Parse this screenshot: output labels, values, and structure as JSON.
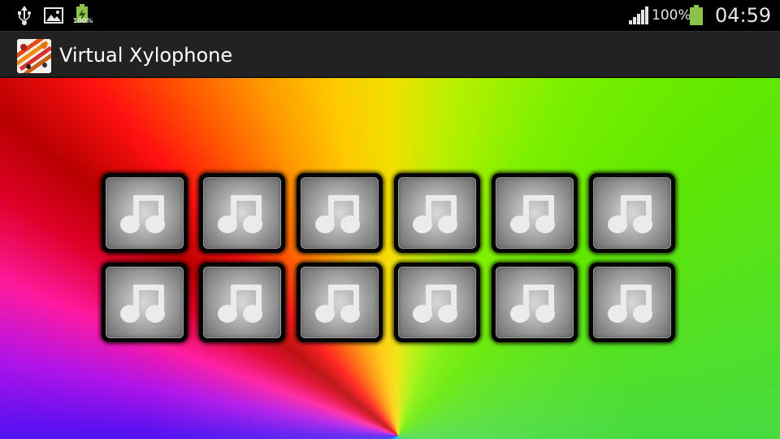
{
  "status_bar": {
    "battery_notification_text": "100%",
    "battery_level": "100%",
    "clock": "04:59",
    "icons": [
      "usb-icon",
      "image-icon",
      "battery-charging-icon",
      "signal-icon",
      "battery-icon"
    ]
  },
  "action_bar": {
    "app_icon": "xylophone-app-icon",
    "title": "Virtual Xylophone"
  },
  "keys": {
    "rows": 2,
    "columns": 6,
    "icon": "music-note-icon"
  },
  "colors": {
    "status_bar_bg": "#000000",
    "action_bar_bg": "#222222",
    "key_border": "#050505",
    "key_face": "#b4b4b4",
    "note_icon": "#ebebeb"
  }
}
